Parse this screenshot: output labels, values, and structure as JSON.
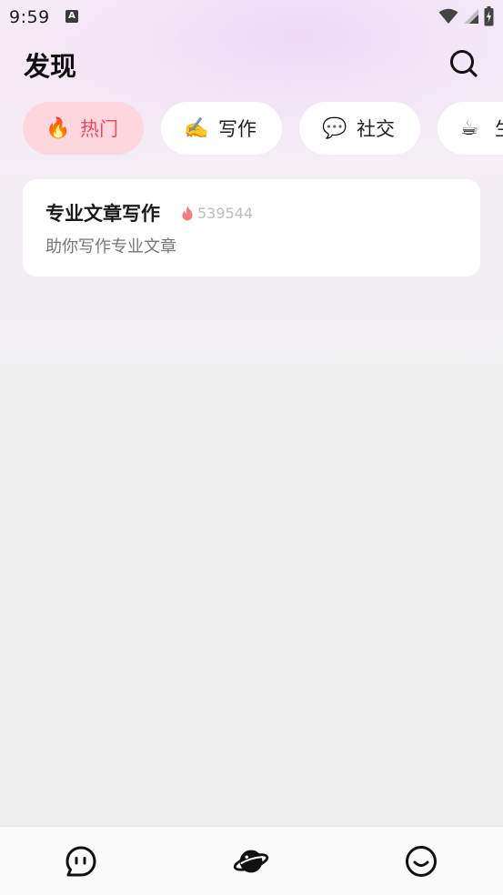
{
  "status_bar": {
    "time": "9:59",
    "notification_icon": "A",
    "icons": [
      "wifi-icon",
      "cell-signal-icon",
      "battery-charging-icon"
    ]
  },
  "header": {
    "title": "发现",
    "search_icon": "search-icon"
  },
  "tabs": [
    {
      "emoji": "🔥",
      "label": "热门",
      "active": true
    },
    {
      "emoji": "✍️",
      "label": "写作",
      "active": false
    },
    {
      "emoji": "💬",
      "label": "社交",
      "active": false
    },
    {
      "emoji": "☕",
      "label": "生",
      "active": false
    }
  ],
  "cards": [
    {
      "title": "专业文章写作",
      "heat_icon": "fire-icon",
      "count": "539544",
      "description": "助你写作专业文章"
    }
  ],
  "bottom_nav": [
    {
      "icon": "chat-face-icon",
      "active": false
    },
    {
      "icon": "planet-icon",
      "active": true
    },
    {
      "icon": "smile-icon",
      "active": false
    }
  ],
  "colors": {
    "accent": "#f4495f",
    "active_tab_bg": "#fed7de",
    "card_bg": "#ffffff",
    "page_bg": "#f1f0f1"
  }
}
